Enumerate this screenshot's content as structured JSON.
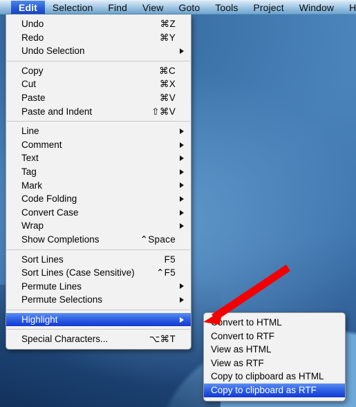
{
  "menubar": {
    "items": [
      {
        "label": "Edit",
        "active": true
      },
      {
        "label": "Selection",
        "active": false
      },
      {
        "label": "Find",
        "active": false
      },
      {
        "label": "View",
        "active": false
      },
      {
        "label": "Goto",
        "active": false
      },
      {
        "label": "Tools",
        "active": false
      },
      {
        "label": "Project",
        "active": false
      },
      {
        "label": "Window",
        "active": false
      },
      {
        "label": "Help",
        "active": false
      }
    ]
  },
  "edit_menu": {
    "groups": [
      {
        "items": [
          {
            "label": "Undo",
            "shortcut": "⌘Z",
            "submenu": false,
            "selected": false
          },
          {
            "label": "Redo",
            "shortcut": "⌘Y",
            "submenu": false,
            "selected": false
          },
          {
            "label": "Undo Selection",
            "shortcut": "",
            "submenu": true,
            "selected": false
          }
        ]
      },
      {
        "items": [
          {
            "label": "Copy",
            "shortcut": "⌘C",
            "submenu": false,
            "selected": false
          },
          {
            "label": "Cut",
            "shortcut": "⌘X",
            "submenu": false,
            "selected": false
          },
          {
            "label": "Paste",
            "shortcut": "⌘V",
            "submenu": false,
            "selected": false
          },
          {
            "label": "Paste and Indent",
            "shortcut": "⇧⌘V",
            "submenu": false,
            "selected": false
          }
        ]
      },
      {
        "items": [
          {
            "label": "Line",
            "shortcut": "",
            "submenu": true,
            "selected": false
          },
          {
            "label": "Comment",
            "shortcut": "",
            "submenu": true,
            "selected": false
          },
          {
            "label": "Text",
            "shortcut": "",
            "submenu": true,
            "selected": false
          },
          {
            "label": "Tag",
            "shortcut": "",
            "submenu": true,
            "selected": false
          },
          {
            "label": "Mark",
            "shortcut": "",
            "submenu": true,
            "selected": false
          },
          {
            "label": "Code Folding",
            "shortcut": "",
            "submenu": true,
            "selected": false
          },
          {
            "label": "Convert Case",
            "shortcut": "",
            "submenu": true,
            "selected": false
          },
          {
            "label": "Wrap",
            "shortcut": "",
            "submenu": true,
            "selected": false
          },
          {
            "label": "Show Completions",
            "shortcut": "⌃Space",
            "submenu": false,
            "selected": false
          }
        ]
      },
      {
        "items": [
          {
            "label": "Sort Lines",
            "shortcut": "F5",
            "submenu": false,
            "selected": false
          },
          {
            "label": "Sort Lines (Case Sensitive)",
            "shortcut": "⌃F5",
            "submenu": false,
            "selected": false
          },
          {
            "label": "Permute Lines",
            "shortcut": "",
            "submenu": true,
            "selected": false
          },
          {
            "label": "Permute Selections",
            "shortcut": "",
            "submenu": true,
            "selected": false
          }
        ]
      },
      {
        "items": [
          {
            "label": "Highlight",
            "shortcut": "",
            "submenu": true,
            "selected": true
          }
        ]
      },
      {
        "items": [
          {
            "label": "Special Characters...",
            "shortcut": "⌥⌘T",
            "submenu": false,
            "selected": false
          }
        ]
      }
    ]
  },
  "highlight_submenu": {
    "items": [
      {
        "label": "Convert to HTML",
        "selected": false
      },
      {
        "label": "Convert to RTF",
        "selected": false
      },
      {
        "label": "View as HTML",
        "selected": false
      },
      {
        "label": "View as RTF",
        "selected": false
      },
      {
        "label": "Copy to clipboard as HTML",
        "selected": false
      },
      {
        "label": "Copy to clipboard as RTF",
        "selected": true
      }
    ]
  },
  "annotation": {
    "arrow_color": "#f20000",
    "icon": "arrow-pointer-icon"
  },
  "colors": {
    "selection_blue": "#2f62e3",
    "menu_background": "#f2f2f2",
    "desktop_blue": "#4a83ba"
  }
}
